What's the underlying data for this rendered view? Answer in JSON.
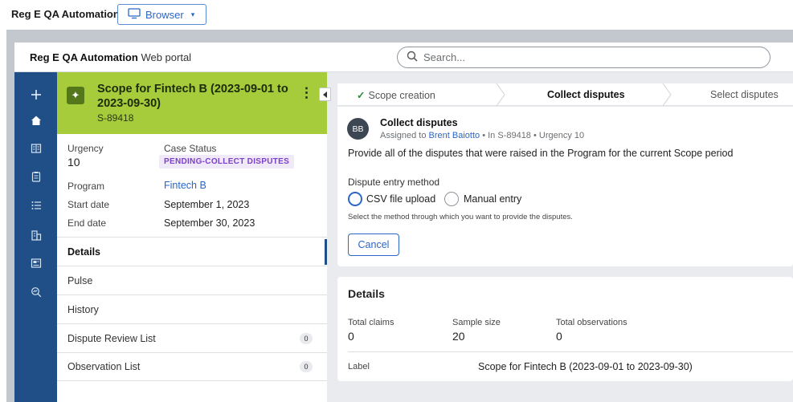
{
  "topbar": {
    "app_name": "Reg E QA Automation",
    "browser_label": "Browser",
    "browser_caret": "▾"
  },
  "header": {
    "portal_name": "Reg E QA Automation",
    "portal_suffix": "Web portal",
    "search_placeholder": "Search..."
  },
  "leftnav": {
    "icons": [
      "plus-icon",
      "home-icon",
      "book-icon",
      "clipboard-icon",
      "list-icon",
      "building-icon",
      "dashboard-icon",
      "search-analytics-icon"
    ]
  },
  "case": {
    "icon": "✦",
    "title": "Scope for Fintech B (2023-09-01 to 2023-09-30)",
    "id": "S-89418",
    "kebab": "⋮",
    "urgency_label": "Urgency",
    "urgency_value": "10",
    "status_label": "Case Status",
    "status_value": "PENDING-COLLECT DISPUTES",
    "program_label": "Program",
    "program_value": "Fintech B",
    "start_label": "Start date",
    "start_value": "September 1, 2023",
    "end_label": "End date",
    "end_value": "September 30, 2023",
    "tabs": [
      {
        "label": "Details"
      },
      {
        "label": "Pulse"
      },
      {
        "label": "History"
      },
      {
        "label": "Dispute Review List",
        "count": "0"
      },
      {
        "label": "Observation List",
        "count": "0"
      }
    ]
  },
  "stages": [
    {
      "label": "Scope creation",
      "check": "✓"
    },
    {
      "label": "Collect disputes"
    },
    {
      "label": "Select disputes"
    }
  ],
  "assignment": {
    "avatar": "BB",
    "title": "Collect disputes",
    "meta_prefix": "Assigned to",
    "assignee": "Brent Baiotto",
    "meta_suffix": "• In S-89418 • Urgency 10",
    "instructions": "Provide all of the disputes that were raised in the Program for the current Scope period",
    "entry_label": "Dispute entry method",
    "option_csv": "CSV file upload",
    "option_manual": "Manual entry",
    "hint": "Select the method through which you want to provide the disputes.",
    "cancel": "Cancel"
  },
  "details": {
    "title": "Details",
    "total_claims_label": "Total claims",
    "total_claims_value": "0",
    "sample_size_label": "Sample size",
    "sample_size_value": "20",
    "total_obs_label": "Total observations",
    "total_obs_value": "0",
    "label_label": "Label",
    "label_value": "Scope for Fintech B (2023-09-01 to 2023-09-30)"
  },
  "colors": {
    "nav": "#1f4f86",
    "case_header": "#a6cc3c",
    "accent": "#2b66c8",
    "status_badge": "#7c3fc8",
    "check": "#2e8b3a"
  }
}
